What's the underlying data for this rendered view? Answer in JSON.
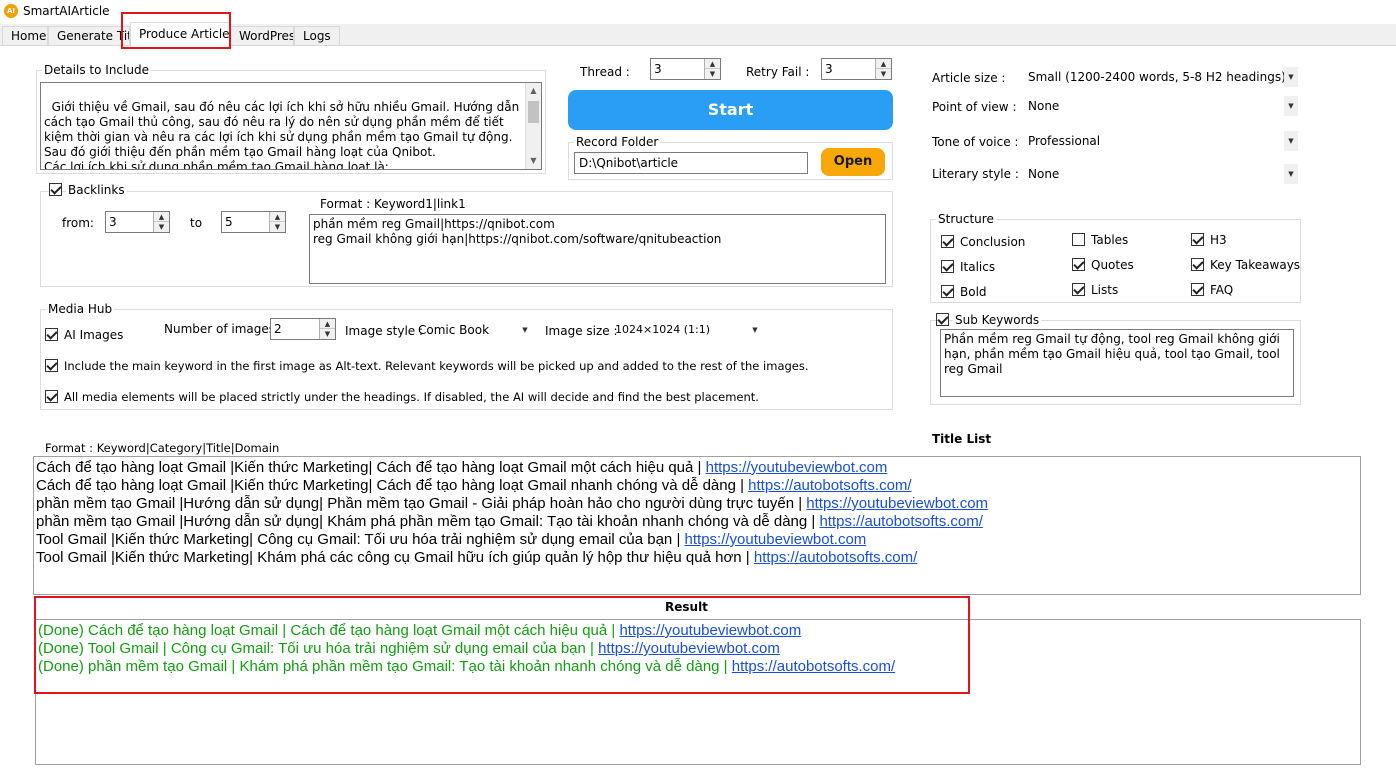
{
  "app": {
    "title": "SmartAIArticle",
    "icon": "app-logo-icon",
    "icon_text": "AI"
  },
  "tabs": [
    {
      "label": "Home"
    },
    {
      "label": "Generate Title"
    },
    {
      "label": "Produce Article"
    },
    {
      "label": "WordPress"
    },
    {
      "label": "Logs"
    }
  ],
  "details": {
    "label": "Details to Include",
    "text": "Giới thiệu về Gmail, sau đó nêu các lợi ích khi sở hữu nhiều Gmail. Hướng dẫn cách tạo Gmail thủ công, sau đó nêu ra lý do nên sử dụng phần mềm để tiết kiệm thời gian và nêu ra các lợi ích khi sử dụng phần mềm tạo Gmail tự động. Sau đó giới thiệu đến phần mềm tạo Gmail hàng loạt của Qnibot.\nCác lợi ích khi sử dụng phần mềm tạo Gmail hàng loạt là:\n- Chạy đa luồng:"
  },
  "thread": {
    "label": "Thread :",
    "value": "3"
  },
  "retry": {
    "label": "Retry Fail :",
    "value": "3"
  },
  "start_label": "Start",
  "record_folder": {
    "label": "Record Folder",
    "value": "D:\\Qnibot\\article",
    "open_label": "Open"
  },
  "backlinks": {
    "label": "Backlinks",
    "checked": true,
    "from_label": "from:",
    "from_value": "3",
    "to_label": "to",
    "to_value": "5",
    "format_label": "Format : Keyword1|link1",
    "text": "phần mềm reg Gmail|https://qnibot.com\nreg Gmail không giới hạn|https://qnibot.com/software/qnitubeaction"
  },
  "media": {
    "label": "Media Hub",
    "ai_images_label": "AI Images",
    "ai_images_checked": true,
    "num_images_label": "Number of images",
    "num_images_value": "2",
    "image_style_label": "Image style :",
    "image_style_value": "Comic Book",
    "image_size_label": "Image size :",
    "image_size_value": "1024×1024 (1:1)",
    "alt_text_label": "Include the main keyword in the first image as Alt-text. Relevant keywords will be picked up and added to the rest of the images.",
    "alt_text_checked": true,
    "placement_label": "All media elements will be placed strictly under the headings. If disabled, the AI will decide and find the best placement.",
    "placement_checked": true
  },
  "settings": {
    "article_size_label": "Article size :",
    "article_size_value": "Small (1200-2400 words, 5-8 H2 headings)",
    "pov_label": "Point of view :",
    "pov_value": "None",
    "tone_label": "Tone of voice :",
    "tone_value": "Professional",
    "literary_label": "Literary style :",
    "literary_value": "None"
  },
  "structure": {
    "label": "Structure",
    "items": [
      {
        "label": "Conclusion",
        "checked": true
      },
      {
        "label": "Tables",
        "checked": false
      },
      {
        "label": "H3",
        "checked": true
      },
      {
        "label": "Italics",
        "checked": true
      },
      {
        "label": "Quotes",
        "checked": true
      },
      {
        "label": "Key Takeaways",
        "checked": true
      },
      {
        "label": "Bold",
        "checked": true
      },
      {
        "label": "Lists",
        "checked": true
      },
      {
        "label": "FAQ",
        "checked": true
      }
    ]
  },
  "sub_keywords": {
    "label": "Sub Keywords",
    "checked": true,
    "text": "Phần mềm reg Gmail tự động, tool reg Gmail không giới hạn, phần mềm tạo Gmail hiệu quả, tool tạo Gmail, tool reg Gmail"
  },
  "title_list": {
    "format_label": "Format : Keyword|Category|Title|Domain",
    "header": "Title List",
    "rows": [
      {
        "text": "Cách để tạo hàng loạt Gmail |Kiến thức Marketing| Cách để tạo hàng loạt Gmail một cách hiệu quả   | ",
        "link": "https://youtubeviewbot.com"
      },
      {
        "text": "Cách để tạo hàng loạt Gmail |Kiến thức Marketing| Cách để tạo hàng loạt Gmail nhanh chóng và dễ dàng | ",
        "link": "https://autobotsofts.com/"
      },
      {
        "text": "phần mềm tạo Gmail |Hướng dẫn sử dụng| Phần mềm tạo Gmail - Giải pháp hoàn hảo cho người dùng trực tuyến   | ",
        "link": "https://youtubeviewbot.com"
      },
      {
        "text": "phần mềm tạo Gmail |Hướng dẫn sử dụng| Khám phá phần mềm tạo Gmail: Tạo tài khoản nhanh chóng và dễ dàng | ",
        "link": "https://autobotsofts.com/"
      },
      {
        "text": "Tool Gmail |Kiến thức Marketing| Công cụ Gmail: Tối ưu hóa trải nghiệm sử dụng email của bạn   | ",
        "link": "https://youtubeviewbot.com"
      },
      {
        "text": "Tool Gmail |Kiến thức Marketing| Khám phá các công cụ Gmail hữu ích giúp quản lý hộp thư hiệu quả hơn | ",
        "link": "https://autobotsofts.com/"
      }
    ]
  },
  "result": {
    "header": "Result",
    "rows": [
      {
        "text": "(Done) Cách để tạo hàng loạt Gmail  |  Cách để tạo hàng loạt Gmail một cách hiệu quả    |  ",
        "link": "https://youtubeviewbot.com"
      },
      {
        "text": "(Done) Tool Gmail  |  Công cụ Gmail: Tối ưu hóa trải nghiệm sử dụng email của bạn    |  ",
        "link": "https://youtubeviewbot.com"
      },
      {
        "text": "(Done) phần mềm tạo Gmail  |  Khám phá phần mềm tạo Gmail: Tạo tài khoản nhanh chóng và dễ dàng  |  ",
        "link": "https://autobotsofts.com/"
      }
    ]
  },
  "colors": {
    "start": "#2a9df4",
    "open": "#f7a808",
    "highlight": "#e0141e",
    "done": "#149b14",
    "link": "#1a4ed6"
  }
}
